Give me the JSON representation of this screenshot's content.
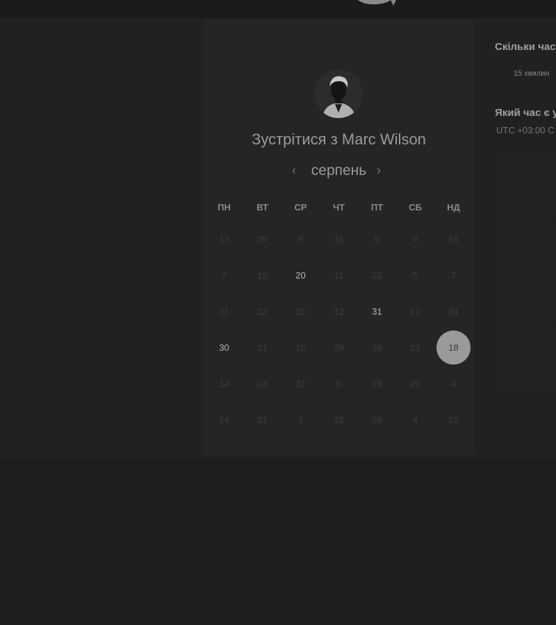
{
  "header": {
    "title_prefix": "Зустрітися з",
    "host_name": "Marc Wilson"
  },
  "calendar": {
    "month": "серпень",
    "prev_icon": "chevron-left-icon",
    "next_icon": "chevron-right-icon",
    "weekdays": [
      "ПН",
      "ВТ",
      "СР",
      "ЧТ",
      "ПТ",
      "СБ",
      "НД"
    ],
    "weeks": [
      [
        {
          "d": "13"
        },
        {
          "d": "25"
        },
        {
          "d": "3"
        },
        {
          "d": "31"
        },
        {
          "d": "6"
        },
        {
          "d": "8"
        },
        {
          "d": "16"
        }
      ],
      [
        {
          "d": "7"
        },
        {
          "d": "19"
        },
        {
          "d": "20",
          "s": "a"
        },
        {
          "d": "11"
        },
        {
          "d": "23"
        },
        {
          "d": "5"
        },
        {
          "d": "7"
        }
      ],
      [
        {
          "d": "21"
        },
        {
          "d": "22"
        },
        {
          "d": "15"
        },
        {
          "d": "12"
        },
        {
          "d": "31",
          "s": "a"
        },
        {
          "d": "12"
        },
        {
          "d": "24"
        }
      ],
      [
        {
          "d": "30",
          "s": "a"
        },
        {
          "d": "21"
        },
        {
          "d": "15"
        },
        {
          "d": "29"
        },
        {
          "d": "30"
        },
        {
          "d": "23"
        },
        {
          "d": "18",
          "s": "sel"
        }
      ],
      [
        {
          "d": "14"
        },
        {
          "d": "18"
        },
        {
          "d": "17"
        },
        {
          "d": "6"
        },
        {
          "d": "19"
        },
        {
          "d": "20"
        },
        {
          "d": "4"
        }
      ],
      [
        {
          "d": "14"
        },
        {
          "d": "31"
        },
        {
          "d": "3"
        },
        {
          "d": "23"
        },
        {
          "d": "29"
        },
        {
          "d": "4"
        },
        {
          "d": "15"
        }
      ]
    ]
  },
  "side": {
    "duration_question": "Скільки час",
    "duration_value": "15 хвилин",
    "timezone_question": "Який час є у",
    "timezone_value": "UTC +03:00 C"
  },
  "colors": {
    "background": "#1e1e1e",
    "card": "#252525",
    "selected_day": "#9a9a9a"
  }
}
